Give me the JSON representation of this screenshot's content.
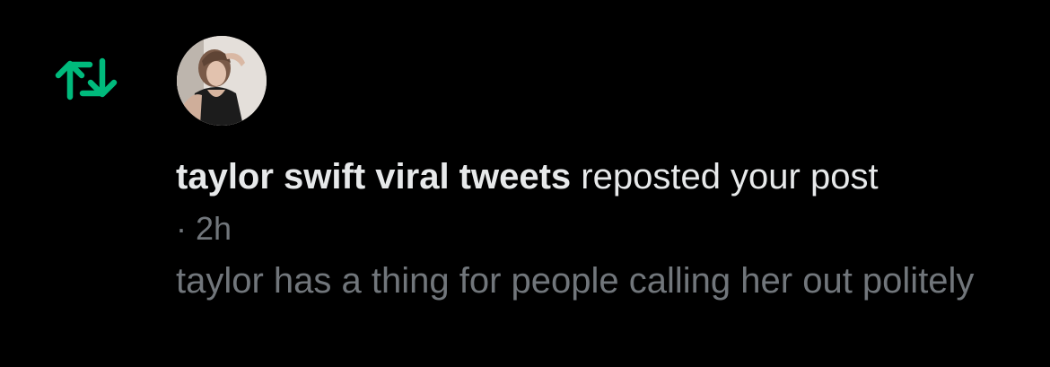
{
  "notification": {
    "icon": "repost-icon",
    "accent_color": "#00ba7c",
    "avatar_icon": "avatar",
    "user_name": "taylor swift viral tweets",
    "action_text": " reposted your post",
    "separator": "·",
    "time_ago": "2h",
    "post_text": "taylor has a thing for people calling her out politely"
  }
}
